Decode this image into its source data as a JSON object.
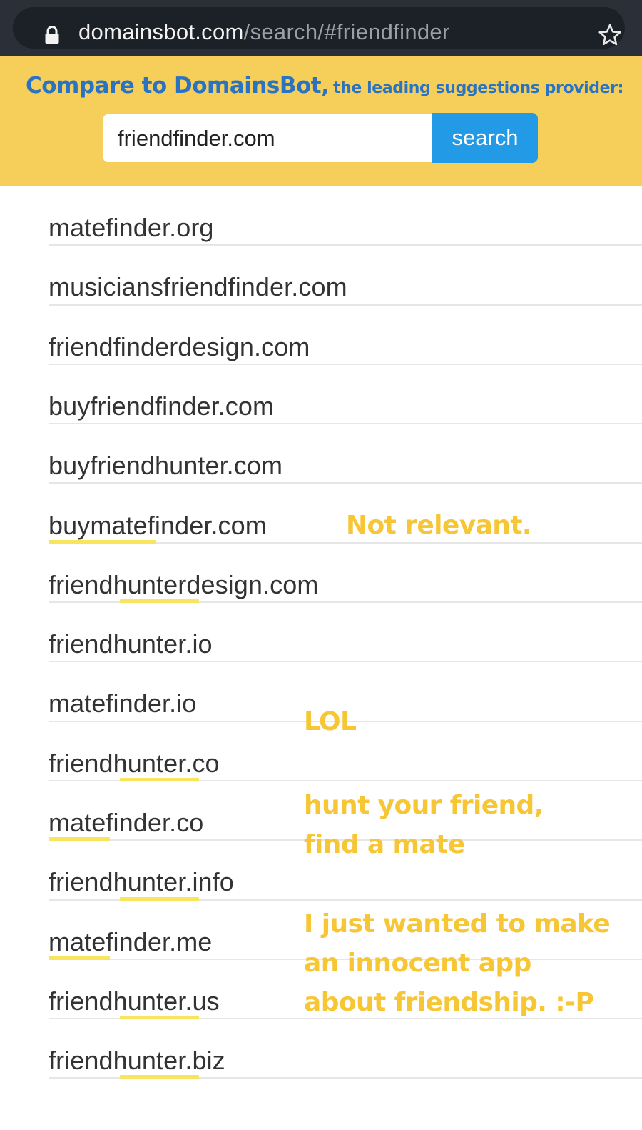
{
  "browser": {
    "url_host": "domainsbot.com",
    "url_path": "/search/#friendfinder",
    "lock_icon": "lock-icon",
    "star_icon": "star-icon"
  },
  "banner": {
    "heading_main": "Compare to DomainsBot,",
    "heading_sub": "the leading suggestions provider:",
    "search_value": "friendfinder.com",
    "search_button_label": "search",
    "background_color": "#f6cf5b",
    "heading_color": "#2a72c2",
    "button_color": "#239ae6"
  },
  "results": [
    {
      "label": "matefinder.org"
    },
    {
      "label": "musiciansfriendfinder.com"
    },
    {
      "label": "friendfinderdesign.com"
    },
    {
      "label": "buyfriendfinder.com"
    },
    {
      "label": "buyfriendhunter.com"
    },
    {
      "label": "buymatefinder.com"
    },
    {
      "label": "friendhunterdesign.com"
    },
    {
      "label": "friendhunter.io"
    },
    {
      "label": "matefinder.io"
    },
    {
      "label": "friendhunter.co"
    },
    {
      "label": "matefinder.co"
    },
    {
      "label": "friendhunter.info"
    },
    {
      "label": "matefinder.me"
    },
    {
      "label": "friendhunter.us"
    },
    {
      "label": "friendhunter.biz"
    }
  ],
  "annotations": {
    "not_relevant": "Not relevant.",
    "lol": "LOL",
    "hunt_line1": "hunt your friend,",
    "hunt_line2": "find a mate",
    "innocent_line1": "I just wanted to make",
    "innocent_line2": "an innocent app",
    "innocent_line3": "about friendship. :-P",
    "highlight_color": "#f8e55d",
    "annotation_color": "#f6c635"
  }
}
